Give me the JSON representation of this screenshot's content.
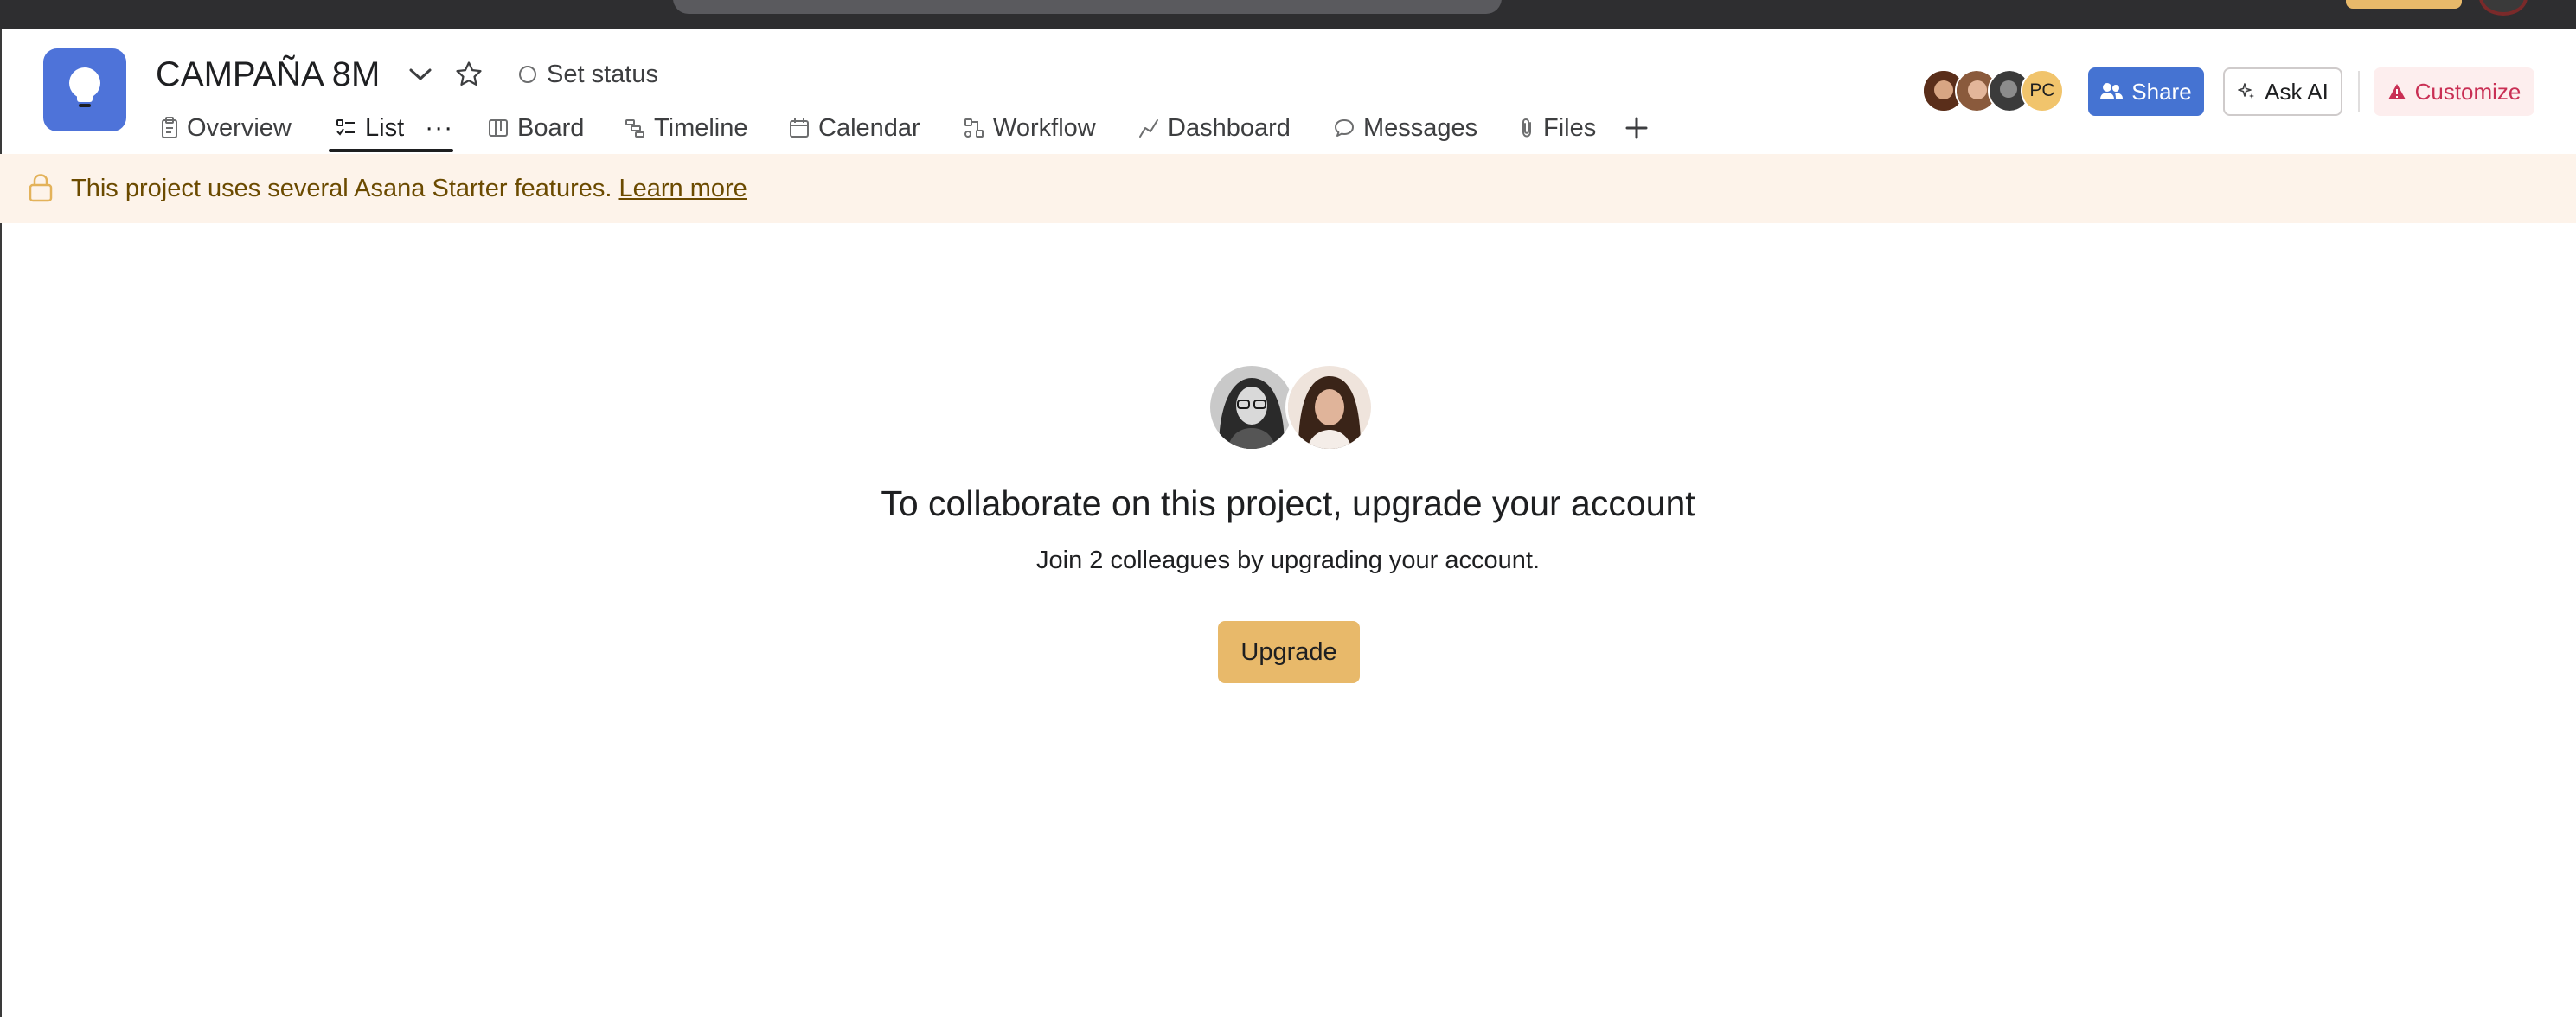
{
  "project": {
    "title": "CAMPAÑA 8M",
    "set_status_label": "Set status"
  },
  "tabs": [
    {
      "label": "Overview",
      "icon": "clipboard-icon"
    },
    {
      "label": "List",
      "icon": "list-icon",
      "active": true
    },
    {
      "label": "Board",
      "icon": "board-icon"
    },
    {
      "label": "Timeline",
      "icon": "timeline-icon"
    },
    {
      "label": "Calendar",
      "icon": "calendar-icon"
    },
    {
      "label": "Workflow",
      "icon": "workflow-icon"
    },
    {
      "label": "Dashboard",
      "icon": "dashboard-icon"
    },
    {
      "label": "Messages",
      "icon": "message-icon"
    },
    {
      "label": "Files",
      "icon": "paperclip-icon"
    }
  ],
  "more_tabs_label": "···",
  "header_right": {
    "avatar_initials": "PC",
    "share_label": "Share",
    "ask_ai_label": "Ask AI",
    "customize_label": "Customize"
  },
  "banner": {
    "text": "This project uses several Asana Starter features.",
    "link_label": "Learn more"
  },
  "upsell": {
    "headline": "To collaborate on this project, upgrade your account",
    "subline": "Join 2 colleagues by upgrading your account.",
    "button_label": "Upgrade"
  },
  "colors": {
    "brand_blue": "#4573d2",
    "project_icon": "#4e73d9",
    "upgrade": "#e8b96a",
    "banner_bg": "#fdf3ea",
    "customize_text": "#c92f54"
  }
}
